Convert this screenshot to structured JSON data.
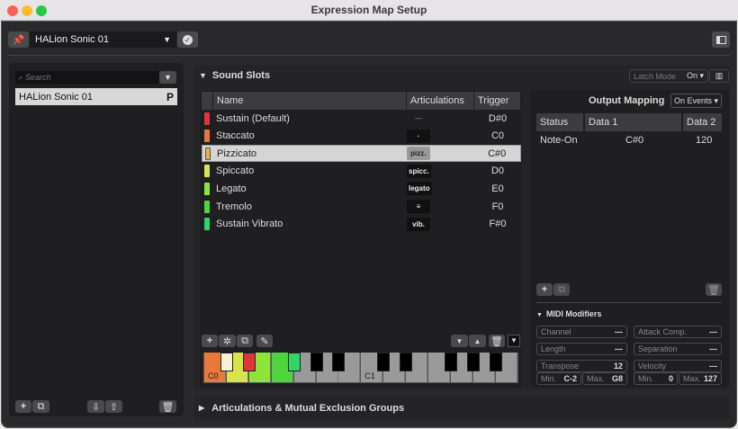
{
  "window": {
    "title": "Expression Map Setup"
  },
  "toolbar": {
    "instrument": "HALion Sonic 01"
  },
  "left": {
    "search_placeholder": "Search",
    "items": [
      {
        "label": "HALion Sonic 01",
        "badge": "P"
      }
    ]
  },
  "sound_slots": {
    "title": "Sound Slots",
    "latch_label": "Latch Mode",
    "latch_value": "On",
    "columns": [
      "Name",
      "Articulations",
      "Trigger"
    ],
    "rows": [
      {
        "color": "#e0343a",
        "name": "Sustain (Default)",
        "articulation": "---",
        "trigger": "D#0"
      },
      {
        "color": "#e8793a",
        "name": "Staccato",
        "articulation": "·",
        "trigger": "C0"
      },
      {
        "color": "#e8b040",
        "name": "Pizzicato",
        "articulation": "pizz.",
        "trigger": "C#0",
        "selected": true
      },
      {
        "color": "#d8e44a",
        "name": "Spiccato",
        "articulation": "spicc.",
        "trigger": "D0"
      },
      {
        "color": "#8ee43a",
        "name": "Legato",
        "articulation": "legato",
        "trigger": "E0"
      },
      {
        "color": "#4fd43f",
        "name": "Tremolo",
        "articulation": "≡",
        "trigger": "F0"
      },
      {
        "color": "#2ed66a",
        "name": "Sustain Vibrato",
        "articulation": "vib.",
        "trigger": "F#0"
      }
    ],
    "keyboard": {
      "labels": [
        "C0",
        "C1"
      ]
    }
  },
  "output": {
    "title": "Output Mapping",
    "mode": "On Events",
    "columns": [
      "Status",
      "Data 1",
      "Data 2"
    ],
    "rows": [
      {
        "status": "Note-On",
        "data1": "C#0",
        "data2": "120"
      }
    ]
  },
  "midi": {
    "title": "MIDI Modifiers",
    "channel": {
      "label": "Channel",
      "value": "---"
    },
    "attack": {
      "label": "Attack Comp.",
      "value": "---"
    },
    "length": {
      "label": "Length",
      "value": "---"
    },
    "separation": {
      "label": "Separation",
      "value": "---"
    },
    "transpose": {
      "label": "Transpose",
      "value": "12",
      "min_label": "Min.",
      "min": "C-2",
      "max_label": "Max.",
      "max": "G8"
    },
    "velocity": {
      "label": "Velocity",
      "value": "---",
      "min_label": "Min.",
      "min": "0",
      "max_label": "Max.",
      "max": "127"
    }
  },
  "groups": {
    "title": "Articulations & Mutual Exclusion Groups"
  }
}
